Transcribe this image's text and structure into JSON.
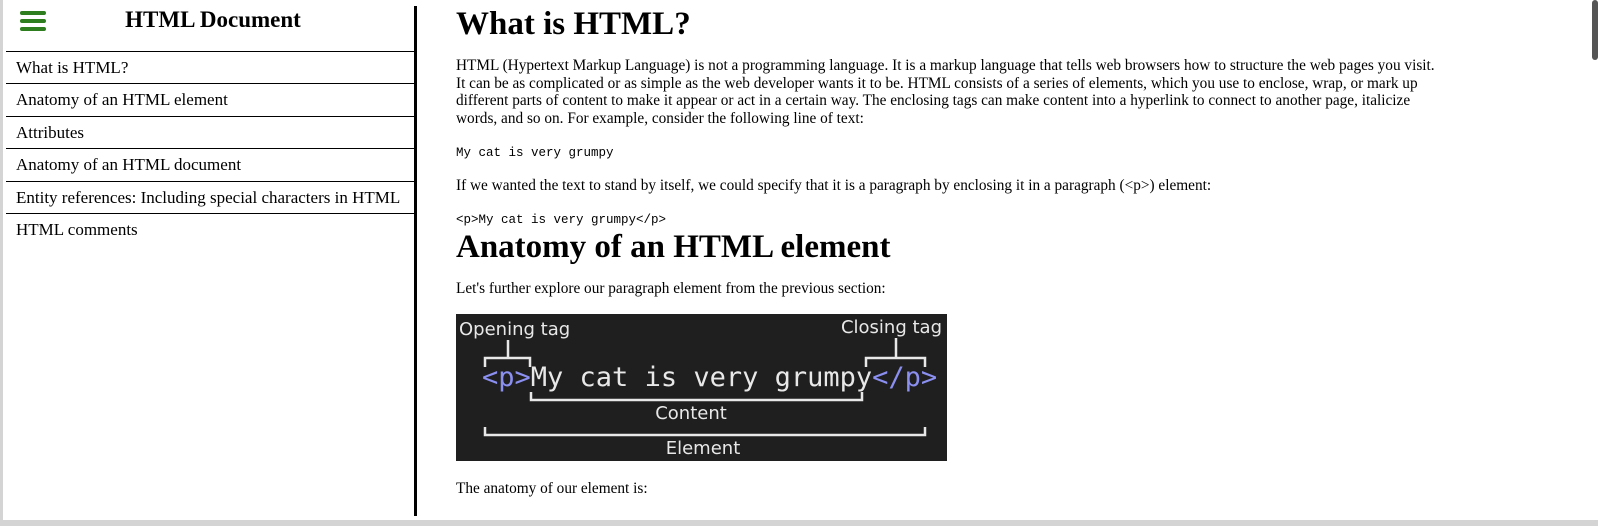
{
  "sidebar": {
    "title": "HTML Document",
    "menu_icon": "hamburger-menu-icon",
    "items": [
      {
        "label": "What is HTML?"
      },
      {
        "label": "Anatomy of an HTML element"
      },
      {
        "label": "Attributes"
      },
      {
        "label": "Anatomy of an HTML document"
      },
      {
        "label": "Entity references: Including special characters in HTML"
      },
      {
        "label": "HTML comments"
      }
    ]
  },
  "main": {
    "heading1": "What is HTML?",
    "paragraph1": "HTML (Hypertext Markup Language) is not a programming language. It is a markup language that tells web browsers how to structure the web pages you visit. It can be as complicated or as simple as the web developer wants it to be. HTML consists of a series of elements, which you use to enclose, wrap, or mark up different parts of content to make it appear or act in a certain way. The enclosing tags can make content into a hyperlink to connect to another page, italicize words, and so on. For example, consider the following line of text:",
    "code1": "My cat is very grumpy",
    "paragraph2": "If we wanted the text to stand by itself, we could specify that it is a paragraph by enclosing it in a paragraph (<p>) element:",
    "code2": "<p>My cat is very grumpy</p>",
    "heading2": "Anatomy of an HTML element",
    "paragraph3": "Let's further explore our paragraph element from the previous section:",
    "diagram": {
      "opening_label": "Opening tag",
      "closing_label": "Closing tag",
      "open_tag": "<p>",
      "content_text": "My cat is very grumpy",
      "close_tag": "</p>",
      "content_label": "Content",
      "element_label": "Element",
      "tag_color": "#8b8ff0",
      "text_color": "#e8e8e8",
      "background": "#1f1f1f"
    },
    "paragraph4": "The anatomy of our element is:"
  }
}
